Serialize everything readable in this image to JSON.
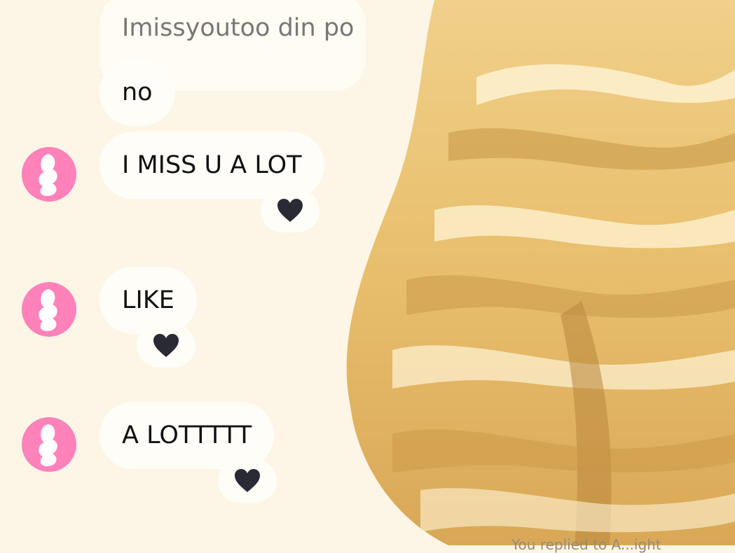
{
  "chat": {
    "messages": [
      {
        "text": "Imissyoutoo din po",
        "quoted": true
      },
      {
        "text": "no"
      },
      {
        "text": "I MISS U A LOT",
        "reaction_icon": "black-heart-icon"
      },
      {
        "text": "LIKE",
        "reaction_icon": "black-heart-icon"
      },
      {
        "text": "A LOTTTTT",
        "reaction_icon": "black-heart-icon"
      }
    ],
    "reaction_color": "#2a2a35",
    "avatar_color": "#ff82ba",
    "footer_text": "You replied to A...ight"
  },
  "colors": {
    "background": "#fdf5e6",
    "bubble": "#fffdf8"
  }
}
